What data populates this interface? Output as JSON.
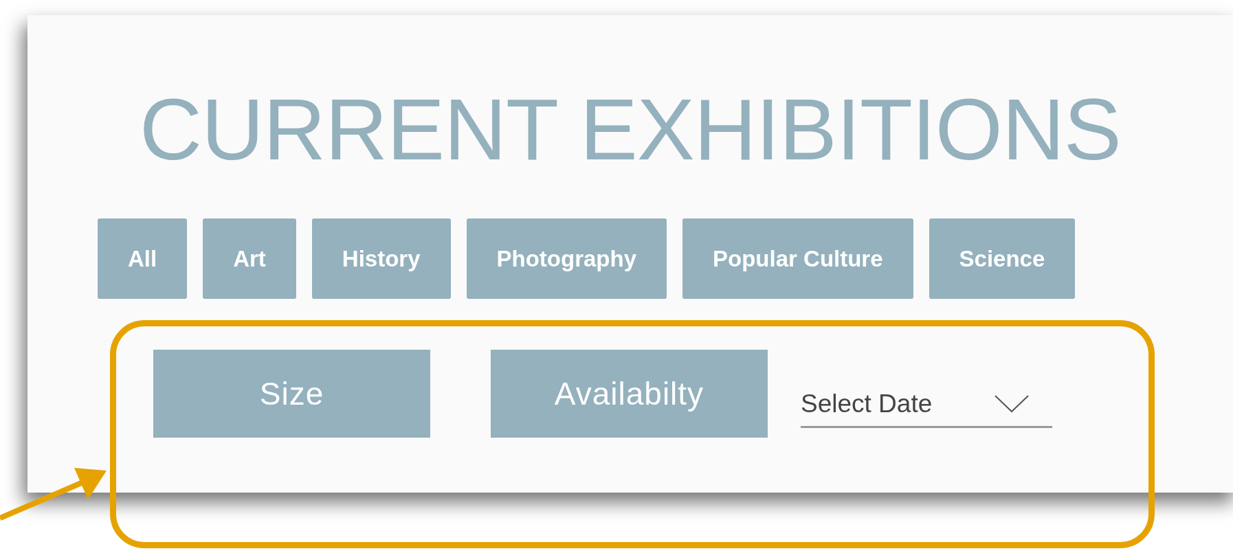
{
  "title": "CURRENT EXHIBITIONS",
  "categories": [
    {
      "label": "All"
    },
    {
      "label": "Art"
    },
    {
      "label": "History"
    },
    {
      "label": "Photography"
    },
    {
      "label": "Popular Culture"
    },
    {
      "label": "Science"
    }
  ],
  "filters": [
    {
      "kind": "button",
      "label": "Size"
    },
    {
      "kind": "button",
      "label": "Availabilty"
    },
    {
      "kind": "dropdown",
      "label": "Select Date"
    }
  ]
}
